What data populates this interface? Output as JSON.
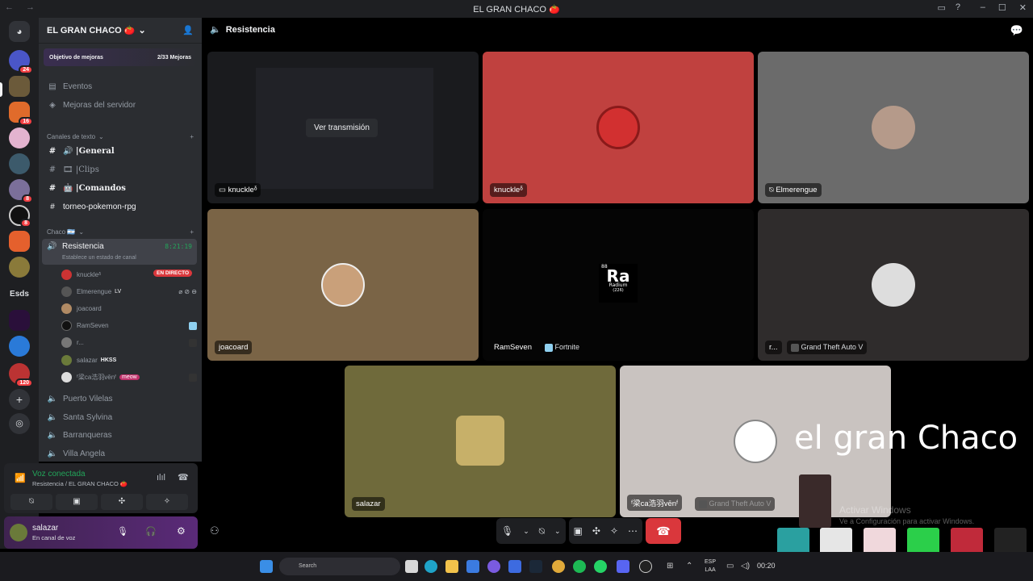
{
  "window": {
    "title": "EL GRAN CHACO 🍅"
  },
  "guilds": [
    {
      "badge": "24"
    },
    {
      "badge": ""
    },
    {
      "badge": "16"
    },
    {
      "badge": ""
    },
    {
      "badge": ""
    },
    {
      "badge": "8"
    },
    {
      "badge": "8"
    },
    {
      "badge": ""
    },
    {
      "badge": ""
    },
    {
      "label": "Esds"
    },
    {
      "badge": ""
    },
    {
      "badge": ""
    },
    {
      "badge": "120"
    }
  ],
  "server": {
    "name": "EL GRAN CHACO 🍅"
  },
  "boost": {
    "label": "Objetivo de mejoras",
    "progress": "2/33 Mejoras"
  },
  "nav": {
    "events": "Eventos",
    "boosts": "Mejoras del servidor"
  },
  "text_category": "Canales de texto",
  "text_channels": [
    {
      "name": "General"
    },
    {
      "name": "Clips"
    },
    {
      "name": "Comandos"
    },
    {
      "name": "torneo-pokemon-rpg"
    }
  ],
  "voice_category": "Chaco 🇦🇷",
  "active_voice": {
    "name": "Resistencia",
    "timer": "8:21:19",
    "status": "Establece un estado de canal"
  },
  "members": [
    {
      "name": "knuckleᵟ",
      "live": "EN DIRECTO"
    },
    {
      "name": "Elmerengue",
      "tag": "LV"
    },
    {
      "name": "joacoard"
    },
    {
      "name": "RamSeven"
    },
    {
      "name": "r..."
    },
    {
      "name": "salazar",
      "tag": "HKSS"
    },
    {
      "name": "ᶠ梁ca浩羽vēnᶠ",
      "tag": "meow"
    }
  ],
  "voice_channels": [
    {
      "name": "Puerto Vilelas"
    },
    {
      "name": "Santa Sylvina"
    },
    {
      "name": "Barranqueras"
    },
    {
      "name": "Villa Angela"
    }
  ],
  "voice_panel": {
    "status": "Voz conectada",
    "location": "Resistencia / EL GRAN CHACO 🍅"
  },
  "user": {
    "name": "salazar",
    "status": "En canal de voz"
  },
  "main": {
    "channel": "Resistencia",
    "stream_button": "Ver transmisión",
    "tiles": [
      {
        "name": "knuckleᵟ"
      },
      {
        "name": "knuckleᵟ"
      },
      {
        "name": "Elmerengue"
      },
      {
        "name": "joacoard"
      },
      {
        "name": "RamSeven",
        "activity": "Fortnite"
      },
      {
        "name": "r...",
        "activity": "Grand Theft Auto V"
      },
      {
        "name": "salazar"
      },
      {
        "name": "ᶠ梁ca浩羽vēnᶠ",
        "activity": "Grand Theft Auto V"
      }
    ],
    "radium": {
      "symbol": "Ra",
      "name": "Radium",
      "number": "88",
      "mass": "(226)"
    }
  },
  "overlay": {
    "text": "el gran Chaco"
  },
  "watermark": {
    "title": "Activar Windows",
    "subtitle": "Ve a Configuración para activar Windows."
  },
  "taskbar": {
    "search": "Search",
    "lang1": "ESP",
    "lang2": "LAA",
    "time": "00:20"
  },
  "colors": {
    "accent": "#5865f2",
    "live": "#da373c",
    "online": "#23a55a"
  }
}
